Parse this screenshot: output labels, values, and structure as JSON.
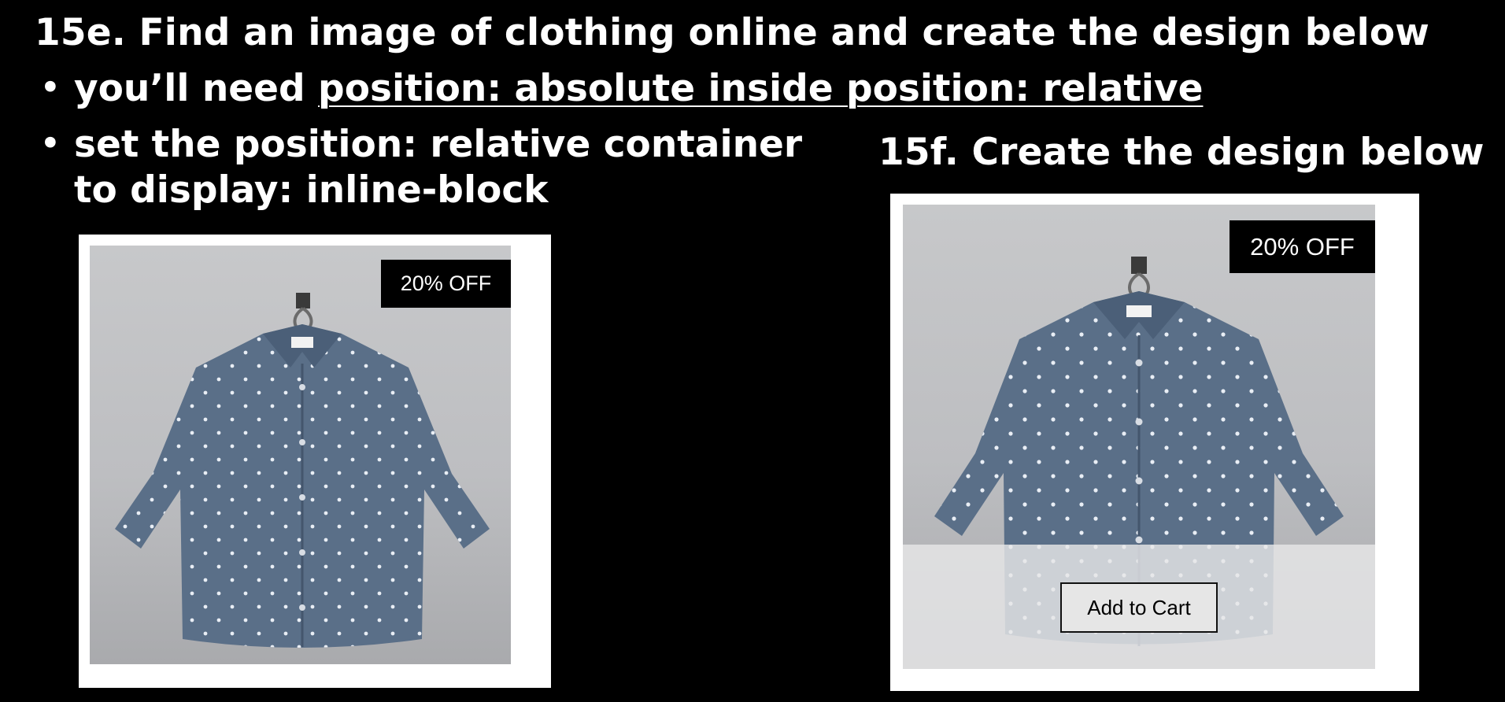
{
  "heading_e": "15e. Find an image of clothing online and create the design below",
  "bullets": [
    {
      "prefix": "you’ll need ",
      "emphasis": "position: absolute inside position: relative"
    },
    {
      "line1": "set the position: relative container",
      "line2": "to display: inline-block"
    }
  ],
  "bullet_glyph": "•",
  "heading_f": "15f. Create the design below",
  "card_e": {
    "badge": "20% OFF",
    "image": "blue-polka-dot-shirt-on-hanger"
  },
  "card_f": {
    "badge": "20% OFF",
    "image": "blue-polka-dot-shirt-on-hanger",
    "button_label": "Add to Cart"
  },
  "colors": {
    "background": "#000000",
    "text": "#ffffff",
    "badge": "#000000",
    "shirt": "#5a6f88"
  }
}
